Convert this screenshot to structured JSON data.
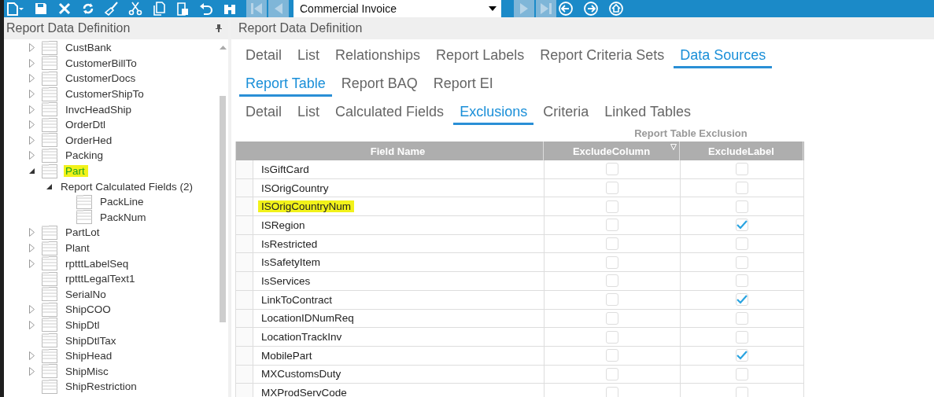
{
  "toolbar": {
    "record": "Commercial Invoice"
  },
  "left_panel": {
    "title": "Report Data Definition",
    "tree": [
      {
        "label": "CustBank",
        "expanded": false,
        "highlighted": false
      },
      {
        "label": "CustomerBillTo",
        "expanded": false,
        "highlighted": false
      },
      {
        "label": "CustomerDocs",
        "expanded": false,
        "highlighted": false
      },
      {
        "label": "CustomerShipTo",
        "expanded": false,
        "highlighted": false
      },
      {
        "label": "InvcHeadShip",
        "expanded": false,
        "highlighted": false
      },
      {
        "label": "OrderDtl",
        "expanded": false,
        "highlighted": false
      },
      {
        "label": "OrderHed",
        "expanded": false,
        "highlighted": false
      },
      {
        "label": "Packing",
        "expanded": false,
        "highlighted": false
      },
      {
        "label": "Part",
        "expanded": true,
        "highlighted": true,
        "children": [
          {
            "label": "Report Calculated Fields (2)",
            "kind": "group",
            "expanded": true,
            "highlighted": false,
            "children": [
              {
                "label": "PackLine",
                "highlighted": false
              },
              {
                "label": "PackNum",
                "highlighted": false
              }
            ]
          }
        ]
      },
      {
        "label": "PartLot",
        "expanded": false,
        "highlighted": false
      },
      {
        "label": "Plant",
        "expanded": false,
        "highlighted": false
      },
      {
        "label": "rptttLabelSeq",
        "expanded": false,
        "highlighted": false
      },
      {
        "label": "rptttLegalText1",
        "highlighted": false
      },
      {
        "label": "SerialNo",
        "highlighted": false
      },
      {
        "label": "ShipCOO",
        "expanded": false,
        "highlighted": false
      },
      {
        "label": "ShipDtl",
        "expanded": false,
        "highlighted": false
      },
      {
        "label": "ShipDtlTax",
        "highlighted": false
      },
      {
        "label": "ShipHead",
        "expanded": false,
        "highlighted": false
      },
      {
        "label": "ShipMisc",
        "expanded": false,
        "highlighted": false
      },
      {
        "label": "ShipRestriction",
        "highlighted": false
      }
    ]
  },
  "right_panel": {
    "title": "Report Data Definition",
    "tabs": [
      {
        "label": "Detail",
        "selected": false
      },
      {
        "label": "List",
        "selected": false
      },
      {
        "label": "Relationships",
        "selected": false
      },
      {
        "label": "Report Labels",
        "selected": false
      },
      {
        "label": "Report Criteria Sets",
        "selected": false
      },
      {
        "label": "Data Sources",
        "selected": true
      }
    ],
    "subtabs": [
      {
        "label": "Report Table",
        "selected": true
      },
      {
        "label": "Report BAQ",
        "selected": false
      },
      {
        "label": "Report EI",
        "selected": false
      }
    ],
    "table_tabs": [
      {
        "label": "Detail",
        "selected": false
      },
      {
        "label": "List",
        "selected": false
      },
      {
        "label": "Calculated Fields",
        "selected": false
      },
      {
        "label": "Exclusions",
        "selected": true
      },
      {
        "label": "Criteria",
        "selected": false
      },
      {
        "label": "Linked Tables",
        "selected": false
      }
    ],
    "grid": {
      "title": "Report Table Exclusion",
      "columns": [
        "Field Name",
        "ExcludeColumn",
        "ExcludeLabel"
      ],
      "rows": [
        {
          "field": "IsGiftCard",
          "exclude_column": false,
          "exclude_label": false,
          "highlighted": false
        },
        {
          "field": "ISOrigCountry",
          "exclude_column": false,
          "exclude_label": false,
          "highlighted": false
        },
        {
          "field": "ISOrigCountryNum",
          "exclude_column": false,
          "exclude_label": false,
          "highlighted": true
        },
        {
          "field": "ISRegion",
          "exclude_column": false,
          "exclude_label": true,
          "highlighted": false
        },
        {
          "field": "IsRestricted",
          "exclude_column": false,
          "exclude_label": false,
          "highlighted": false
        },
        {
          "field": "IsSafetyItem",
          "exclude_column": false,
          "exclude_label": false,
          "highlighted": false
        },
        {
          "field": "IsServices",
          "exclude_column": false,
          "exclude_label": false,
          "highlighted": false
        },
        {
          "field": "LinkToContract",
          "exclude_column": false,
          "exclude_label": true,
          "highlighted": false
        },
        {
          "field": "LocationIDNumReq",
          "exclude_column": false,
          "exclude_label": false,
          "highlighted": false
        },
        {
          "field": "LocationTrackInv",
          "exclude_column": false,
          "exclude_label": false,
          "highlighted": false
        },
        {
          "field": "MobilePart",
          "exclude_column": false,
          "exclude_label": true,
          "highlighted": false
        },
        {
          "field": "MXCustomsDuty",
          "exclude_column": false,
          "exclude_label": false,
          "highlighted": false
        },
        {
          "field": "MXProdServCode",
          "exclude_column": false,
          "exclude_label": false,
          "highlighted": false
        }
      ]
    }
  }
}
